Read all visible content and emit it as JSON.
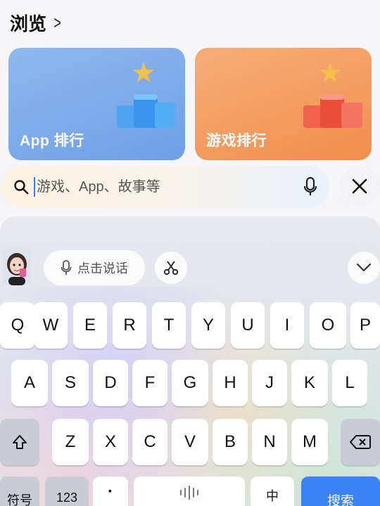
{
  "header": {
    "title": "浏览",
    "chevron": ">"
  },
  "cards": [
    {
      "label": "App 排行",
      "icon": "star-trophy-blue-icon",
      "color": "#6e9fe6"
    },
    {
      "label": "游戏排行",
      "icon": "star-trophy-orange-icon",
      "color": "#f08f4e"
    }
  ],
  "search": {
    "placeholder": "游戏、App、故事等",
    "value": ""
  },
  "voice": {
    "label": "点击说话"
  },
  "keyboard": {
    "row1": [
      "Q",
      "W",
      "E",
      "R",
      "T",
      "Y",
      "U",
      "I",
      "O",
      "P"
    ],
    "row2": [
      "A",
      "S",
      "D",
      "F",
      "G",
      "H",
      "J",
      "K",
      "L"
    ],
    "row3": [
      "Z",
      "X",
      "C",
      "V",
      "B",
      "N",
      "M"
    ],
    "symbols_label": "符号",
    "numbers_label": "123",
    "punct_label": "·",
    "lang_label": "中",
    "search_label": "搜索"
  },
  "colors": {
    "accent": "#3b82f6",
    "app_card": "#6e9fe6",
    "game_card": "#f08f4e"
  }
}
